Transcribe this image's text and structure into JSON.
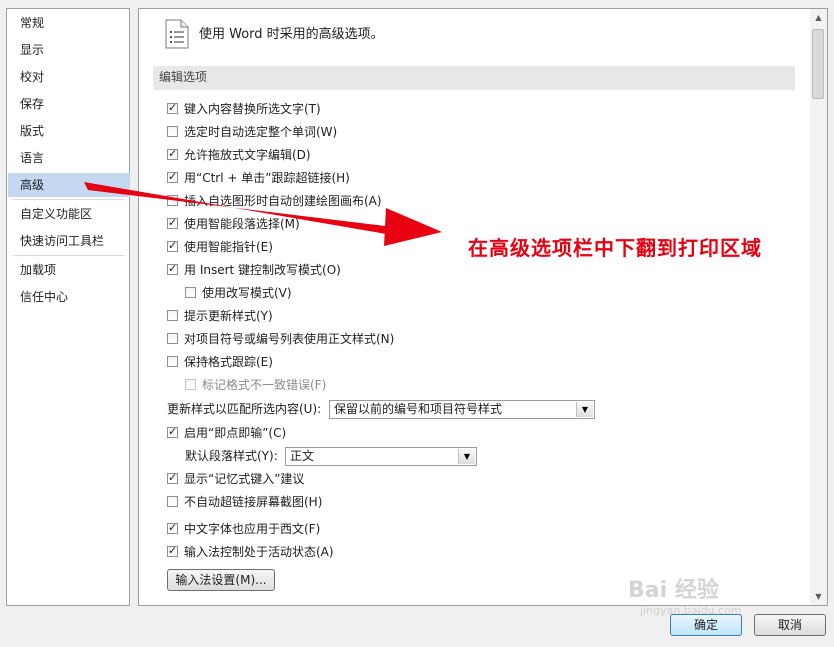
{
  "nav": {
    "items": [
      {
        "label": "常规"
      },
      {
        "label": "显示"
      },
      {
        "label": "校对"
      },
      {
        "label": "保存"
      },
      {
        "label": "版式"
      },
      {
        "label": "语言"
      },
      {
        "label": "高级",
        "selected": true
      },
      {
        "label": "自定义功能区"
      },
      {
        "label": "快速访问工具栏"
      },
      {
        "label": "加载项"
      },
      {
        "label": "信任中心"
      }
    ]
  },
  "header": {
    "text": "使用 Word 时采用的高级选项。",
    "icon": "document-options-icon"
  },
  "section": {
    "title": "编辑选项"
  },
  "options": [
    {
      "label": "键入内容替换所选文字(T)",
      "checked": true
    },
    {
      "label": "选定时自动选定整个单词(W)",
      "checked": false
    },
    {
      "label": "允许拖放式文字编辑(D)",
      "checked": true
    },
    {
      "label": "用“Ctrl + 单击”跟踪超链接(H)",
      "checked": true
    },
    {
      "label": "插入自选图形时自动创建绘图画布(A)",
      "checked": false
    },
    {
      "label": "使用智能段落选择(M)",
      "checked": true
    },
    {
      "label": "使用智能指针(E)",
      "checked": true
    },
    {
      "label": "用 Insert 键控制改写模式(O)",
      "checked": true
    },
    {
      "label": "使用改写模式(V)",
      "checked": false
    },
    {
      "label": "提示更新样式(Y)",
      "checked": false
    },
    {
      "label": "对项目符号或编号列表使用正文样式(N)",
      "checked": false
    },
    {
      "label": "保持格式跟踪(E)",
      "checked": false
    },
    {
      "label": "标记格式不一致错误(F)",
      "checked": false,
      "disabled": true
    },
    {
      "label": "启用“即点即输”(C)",
      "checked": true
    },
    {
      "label": "显示“记忆式键入”建议",
      "checked": true
    },
    {
      "label": "不自动超链接屏幕截图(H)",
      "checked": false
    },
    {
      "label": "中文字体也应用于西文(F)",
      "checked": true
    },
    {
      "label": "输入法控制处于活动状态(A)",
      "checked": true
    }
  ],
  "update_style": {
    "label": "更新样式以匹配所选内容(U):",
    "value": "保留以前的编号和项目符号样式"
  },
  "default_para": {
    "label": "默认段落样式(Y):",
    "value": "正文"
  },
  "ime_button": {
    "label": "输入法设置(M)..."
  },
  "footer": {
    "ok_label": "确定",
    "cancel_label": "取消"
  },
  "annotation": {
    "text": "在高级选项栏中下翻到打印区域",
    "color": "#e60012"
  },
  "watermark": {
    "text": "Bai 经验",
    "sub": "jingyan.baidu.com"
  }
}
